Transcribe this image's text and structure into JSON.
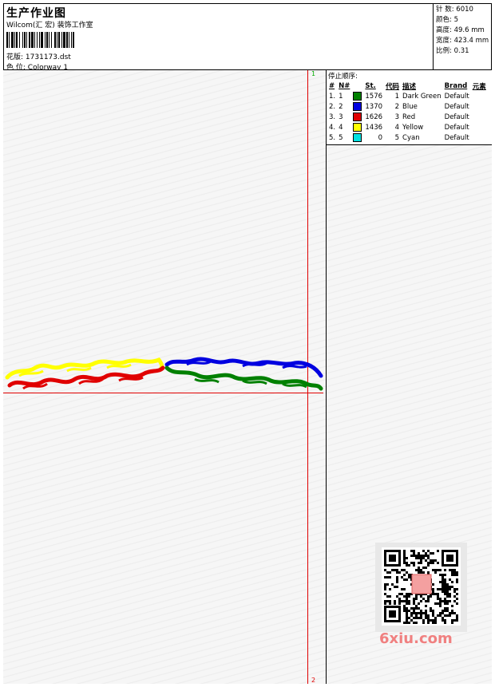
{
  "header": {
    "title": "生产作业图",
    "company": "Wilcom(汇 宏) 装饰工作室",
    "design_label": "花版:",
    "design_value": "1731173.dst",
    "colorway_label": "色 位:",
    "colorway_value": "Colorway 1"
  },
  "stats": {
    "stitches_label": "针 数:",
    "stitches_value": "6010",
    "colors_label": "颜色:",
    "colors_value": "5",
    "height_label": "高度:",
    "height_value": "49.6 mm",
    "width_label": "宽度:",
    "width_value": "423.4 mm",
    "scale_label": "比例:",
    "scale_value": "0.31"
  },
  "stop_sequence": {
    "title": "停止顺序:",
    "columns": [
      "#",
      "N#",
      "St.",
      "代码",
      "描述",
      "Brand",
      "元素"
    ],
    "rows": [
      {
        "idx": "1.",
        "n": "1",
        "st": "1576",
        "code": "1",
        "desc": "Dark Green",
        "brand": "Default",
        "color": "#008000"
      },
      {
        "idx": "2.",
        "n": "2",
        "st": "1370",
        "code": "2",
        "desc": "Blue",
        "brand": "Default",
        "color": "#0000e0"
      },
      {
        "idx": "3.",
        "n": "3",
        "st": "1626",
        "code": "3",
        "desc": "Red",
        "brand": "Default",
        "color": "#e00000"
      },
      {
        "idx": "4.",
        "n": "4",
        "st": "1436",
        "code": "4",
        "desc": "Yellow",
        "brand": "Default",
        "color": "#ffff00"
      },
      {
        "idx": "5.",
        "n": "5",
        "st": "0",
        "code": "5",
        "desc": "Cyan",
        "brand": "Default",
        "color": "#00e0e0"
      }
    ]
  },
  "markers": {
    "top": "1",
    "bottom": "2"
  },
  "watermark": "6xiu.com",
  "colors": {
    "guide_line": "#e00000",
    "marker_top": "#00aa00"
  }
}
